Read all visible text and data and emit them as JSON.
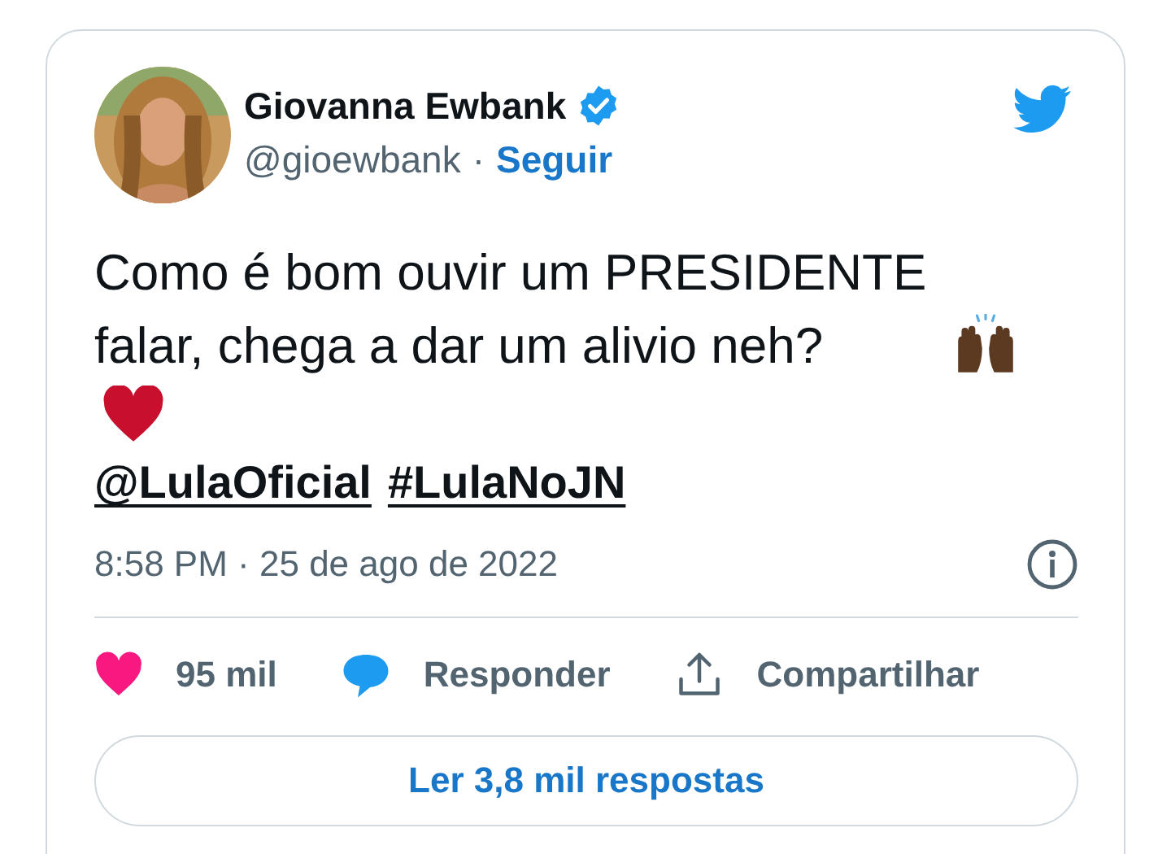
{
  "author": {
    "name": "Giovanna Ewbank",
    "verified": true,
    "handle": "@gioewbank",
    "separator": "·",
    "follow": "Seguir"
  },
  "tweet": {
    "text": "Como é bom ouvir um PRESIDENTE falar, chega a dar um alivio neh?",
    "links": [
      "@LulaOficial",
      "#LulaNoJN"
    ],
    "timestamp": "8:58 PM · 25 de ago de 2022"
  },
  "actions": [
    {
      "kind": "like",
      "label": "95 mil"
    },
    {
      "kind": "reply",
      "label": "Responder"
    },
    {
      "kind": "share",
      "label": "Compartilhar"
    }
  ],
  "replies_button": "Ler 3,8 mil respostas"
}
